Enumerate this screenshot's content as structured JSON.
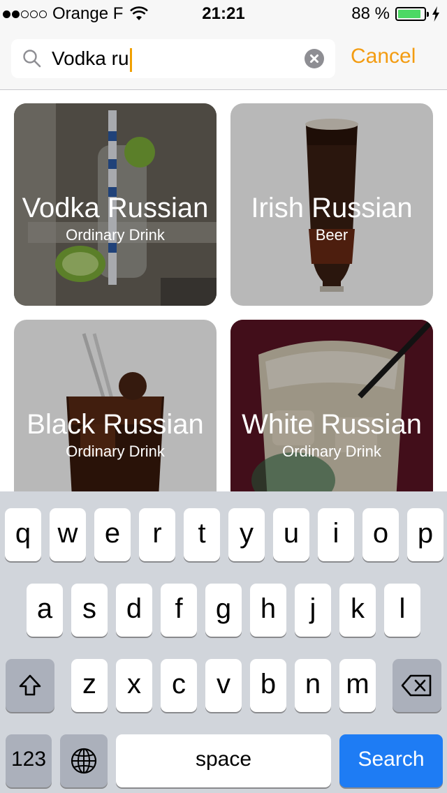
{
  "status": {
    "carrier": "Orange F",
    "time": "21:21",
    "battery": "88 %",
    "battery_level": 0.88,
    "battery_color": "#4cd964"
  },
  "search": {
    "query": "Vodka ru",
    "cancel_label": "Cancel",
    "accent": "#f39c12"
  },
  "results": [
    {
      "title": "Vodka Russian",
      "category": "Ordinary Drink"
    },
    {
      "title": "Irish Russian",
      "category": "Beer"
    },
    {
      "title": "Black Russian",
      "category": "Ordinary Drink"
    },
    {
      "title": "White Russian",
      "category": "Ordinary Drink"
    }
  ],
  "keyboard": {
    "row1": [
      "q",
      "w",
      "e",
      "r",
      "t",
      "y",
      "u",
      "i",
      "o",
      "p"
    ],
    "row2": [
      "a",
      "s",
      "d",
      "f",
      "g",
      "h",
      "j",
      "k",
      "l"
    ],
    "row3": [
      "z",
      "x",
      "c",
      "v",
      "b",
      "n",
      "m"
    ],
    "numbers_label": "123",
    "space_label": "space",
    "search_label": "Search",
    "icons": {
      "shift": "shift-arrow-icon",
      "delete": "backspace-icon",
      "globe": "globe-icon"
    },
    "search_color": "#1e7cf4"
  }
}
